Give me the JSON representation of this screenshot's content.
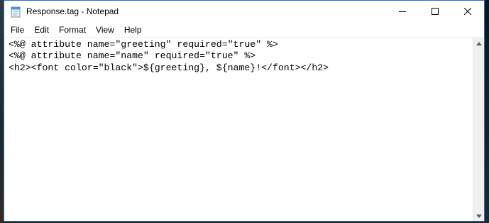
{
  "window": {
    "title": "Response.tag - Notepad",
    "icon": "notepad-icon",
    "accent_color": "#2b6ccf"
  },
  "caption_buttons": {
    "minimize_icon": "minimize-icon",
    "maximize_icon": "maximize-icon",
    "close_icon": "close-icon"
  },
  "menubar": {
    "items": [
      {
        "label": "File"
      },
      {
        "label": "Edit"
      },
      {
        "label": "Format"
      },
      {
        "label": "View"
      },
      {
        "label": "Help"
      }
    ]
  },
  "editor": {
    "lines": [
      "<%@ attribute name=\"greeting\" required=\"true\" %>",
      "<%@ attribute name=\"name\" required=\"true\" %>",
      "<h2><font color=\"black\">${greeting}, ${name}!</font></h2>"
    ]
  },
  "scrollbar": {
    "up_icon": "scroll-up-arrow-icon",
    "down_icon": "scroll-down-arrow-icon"
  }
}
